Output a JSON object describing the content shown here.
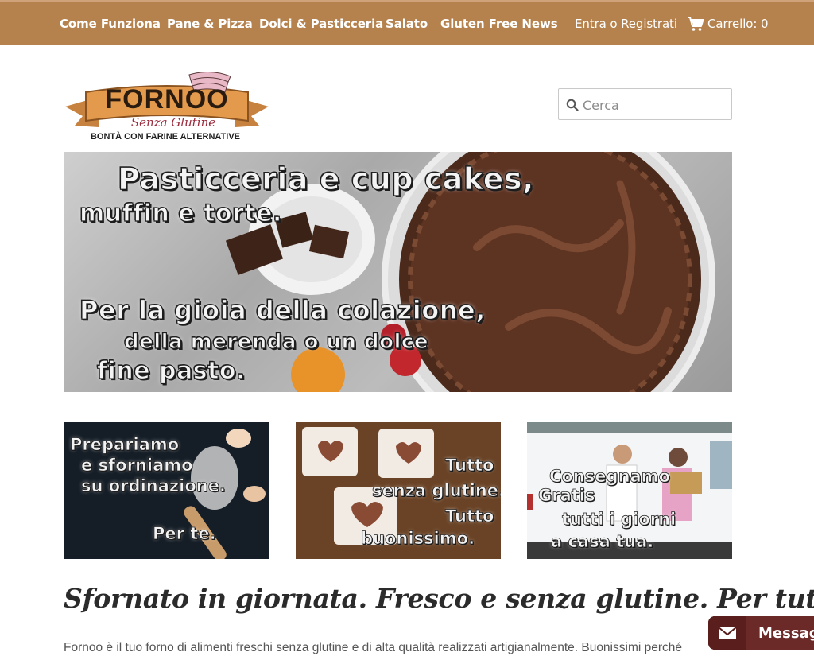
{
  "nav": {
    "items": [
      {
        "label": "Come Funziona"
      },
      {
        "label": "Pane & Pizza"
      },
      {
        "label": "Dolci & Pasticceria"
      },
      {
        "label": "Salato"
      },
      {
        "label": "Gluten Free News"
      }
    ],
    "login_label": "Entra o Registrati",
    "cart_label": "Carrello: 0"
  },
  "logo": {
    "brand": "FORNOO",
    "tagline": "Senza Glutine",
    "subtitle": "BONTÀ CON FARINE ALTERNATIVE"
  },
  "search": {
    "placeholder": "Cerca"
  },
  "hero": {
    "line1": "Pasticceria e cup cakes,",
    "line2": "muffin e torte.",
    "line3": "Per la gioia della colazione,",
    "line4": "della merenda o un dolce",
    "line5": "fine pasto."
  },
  "tiles": [
    {
      "lines": [
        "Prepariamo",
        "e sforniamo",
        "su ordinazione.",
        "Per te."
      ]
    },
    {
      "lines": [
        "Tutto",
        "senza glutine.",
        "Tutto",
        "buonissimo."
      ]
    },
    {
      "lines": [
        "Consegnamo",
        "Gratis",
        "tutti i giorni",
        "a casa tua."
      ]
    }
  ],
  "headline": "Sfornato in giornata. Fresco e senza glutine. Per tutti.",
  "intro": "Fornoo è il tuo forno di alimenti freschi senza glutine e di alta qualità realizzati artigianalmente. Buonissimi perché",
  "message_widget": {
    "label": "Messag"
  },
  "colors": {
    "nav_bg": "#b5824d",
    "accent_pink": "#e9b8c7",
    "widget_bg": "#6b2a28"
  }
}
